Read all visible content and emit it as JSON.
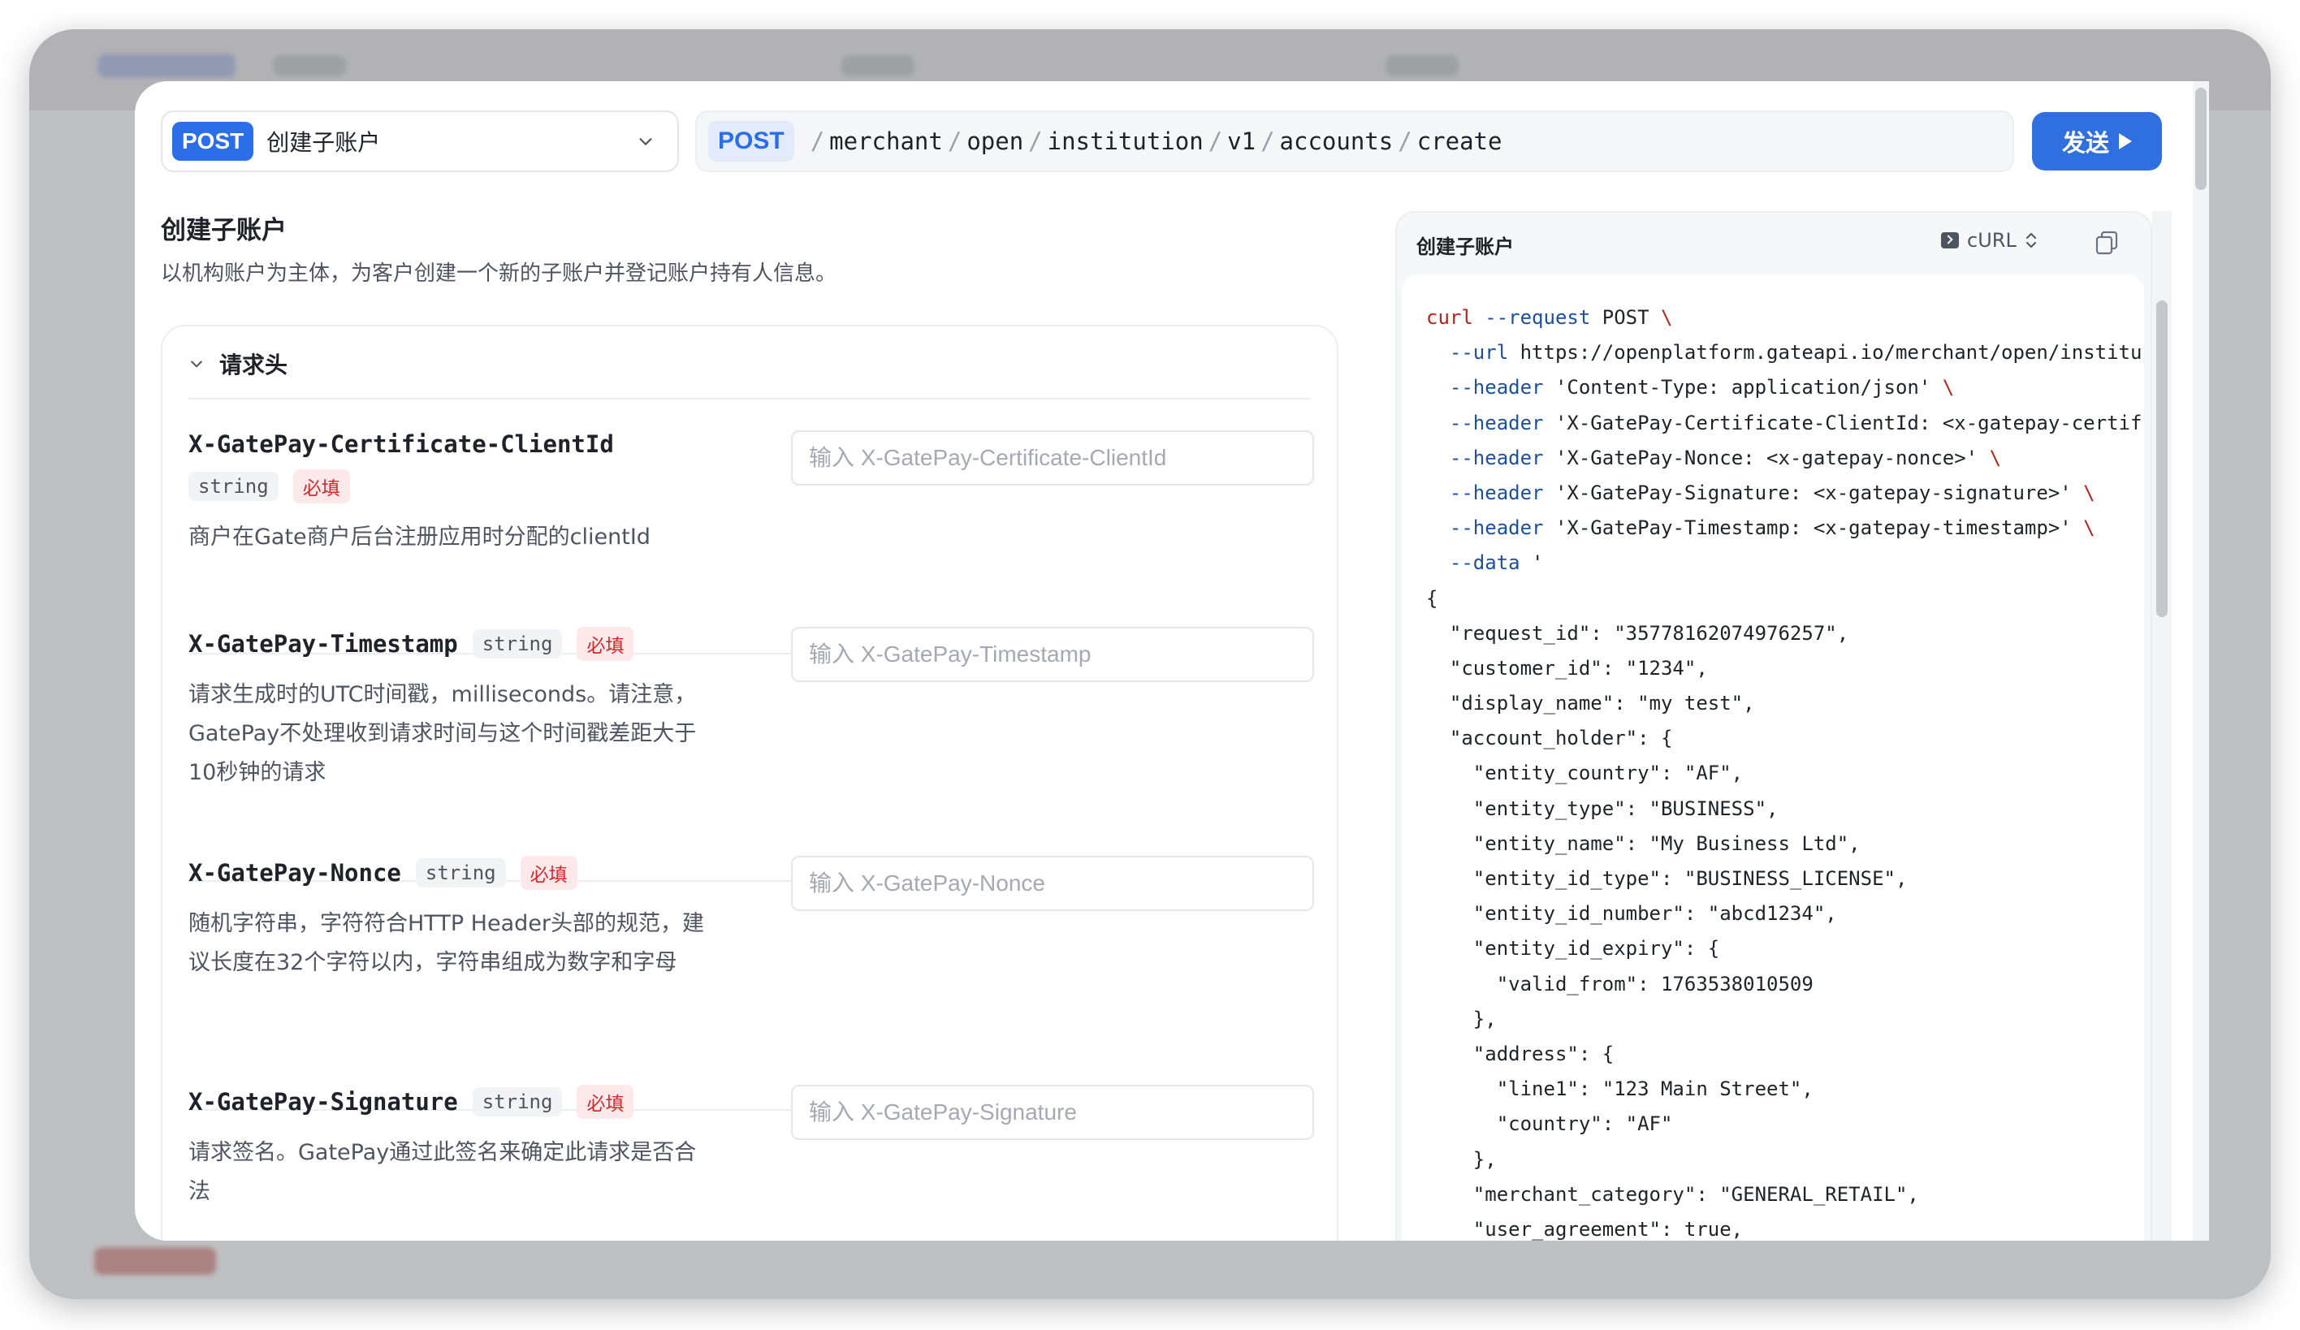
{
  "header": {
    "method": "POST",
    "endpoint_name": "创建子账户",
    "url_method": "POST",
    "path_segments": [
      "merchant",
      "open",
      "institution",
      "v1",
      "accounts",
      "create"
    ],
    "send_label": "发送"
  },
  "page": {
    "title": "创建子账户",
    "description": "以机构账户为主体，为客户创建一个新的子账户并登记账户持有人信息。"
  },
  "headers_section": {
    "title": "请求头",
    "fields": [
      {
        "name": "X-GatePay-Certificate-ClientId",
        "type": "string",
        "required": "必填",
        "description": "商户在Gate商户后台注册应用时分配的clientId",
        "placeholder": "输入 X-GatePay-Certificate-ClientId"
      },
      {
        "name": "X-GatePay-Timestamp",
        "type": "string",
        "required": "必填",
        "description": "请求生成时的UTC时间戳，milliseconds。请注意，GatePay不处理收到请求时间与这个时间戳差距大于10秒钟的请求",
        "placeholder": "输入 X-GatePay-Timestamp"
      },
      {
        "name": "X-GatePay-Nonce",
        "type": "string",
        "required": "必填",
        "description": "随机字符串，字符符合HTTP Header头部的规范，建议长度在32个字符以内，字符串组成为数字和字母",
        "placeholder": "输入 X-GatePay-Nonce"
      },
      {
        "name": "X-GatePay-Signature",
        "type": "string",
        "required": "必填",
        "description": "请求签名。GatePay通过此签名来确定此请求是否合法",
        "placeholder": "输入 X-GatePay-Signature"
      }
    ]
  },
  "code_panel": {
    "title": "创建子账户",
    "language": "cURL",
    "lines": [
      "curl --request POST \\",
      "  --url https://openplatform.gateapi.io/merchant/open/institu",
      "  --header 'Content-Type: application/json' \\",
      "  --header 'X-GatePay-Certificate-ClientId: <x-gatepay-certif",
      "  --header 'X-GatePay-Nonce: <x-gatepay-nonce>' \\",
      "  --header 'X-GatePay-Signature: <x-gatepay-signature>' \\",
      "  --header 'X-GatePay-Timestamp: <x-gatepay-timestamp>' \\",
      "  --data '",
      "{",
      "  \"request_id\": \"35778162074976257\",",
      "  \"customer_id\": \"1234\",",
      "  \"display_name\": \"my test\",",
      "  \"account_holder\": {",
      "    \"entity_country\": \"AF\",",
      "    \"entity_type\": \"BUSINESS\",",
      "    \"entity_name\": \"My Business Ltd\",",
      "    \"entity_id_type\": \"BUSINESS_LICENSE\",",
      "    \"entity_id_number\": \"abcd1234\",",
      "    \"entity_id_expiry\": {",
      "      \"valid_from\": 1763538010509",
      "    },",
      "    \"address\": {",
      "      \"line1\": \"123 Main Street\",",
      "      \"country\": \"AF\"",
      "    },",
      "    \"merchant_category\": \"GENERAL_RETAIL\",",
      "    \"user_agreement\": true,"
    ]
  },
  "colors": {
    "accent": "#2f6fe0",
    "required": "#d3292d",
    "code_keyword": "#b3261e"
  },
  "icons": [
    "chevron-down-icon",
    "play-icon",
    "terminal-icon",
    "sort-icon",
    "copy-icon"
  ]
}
